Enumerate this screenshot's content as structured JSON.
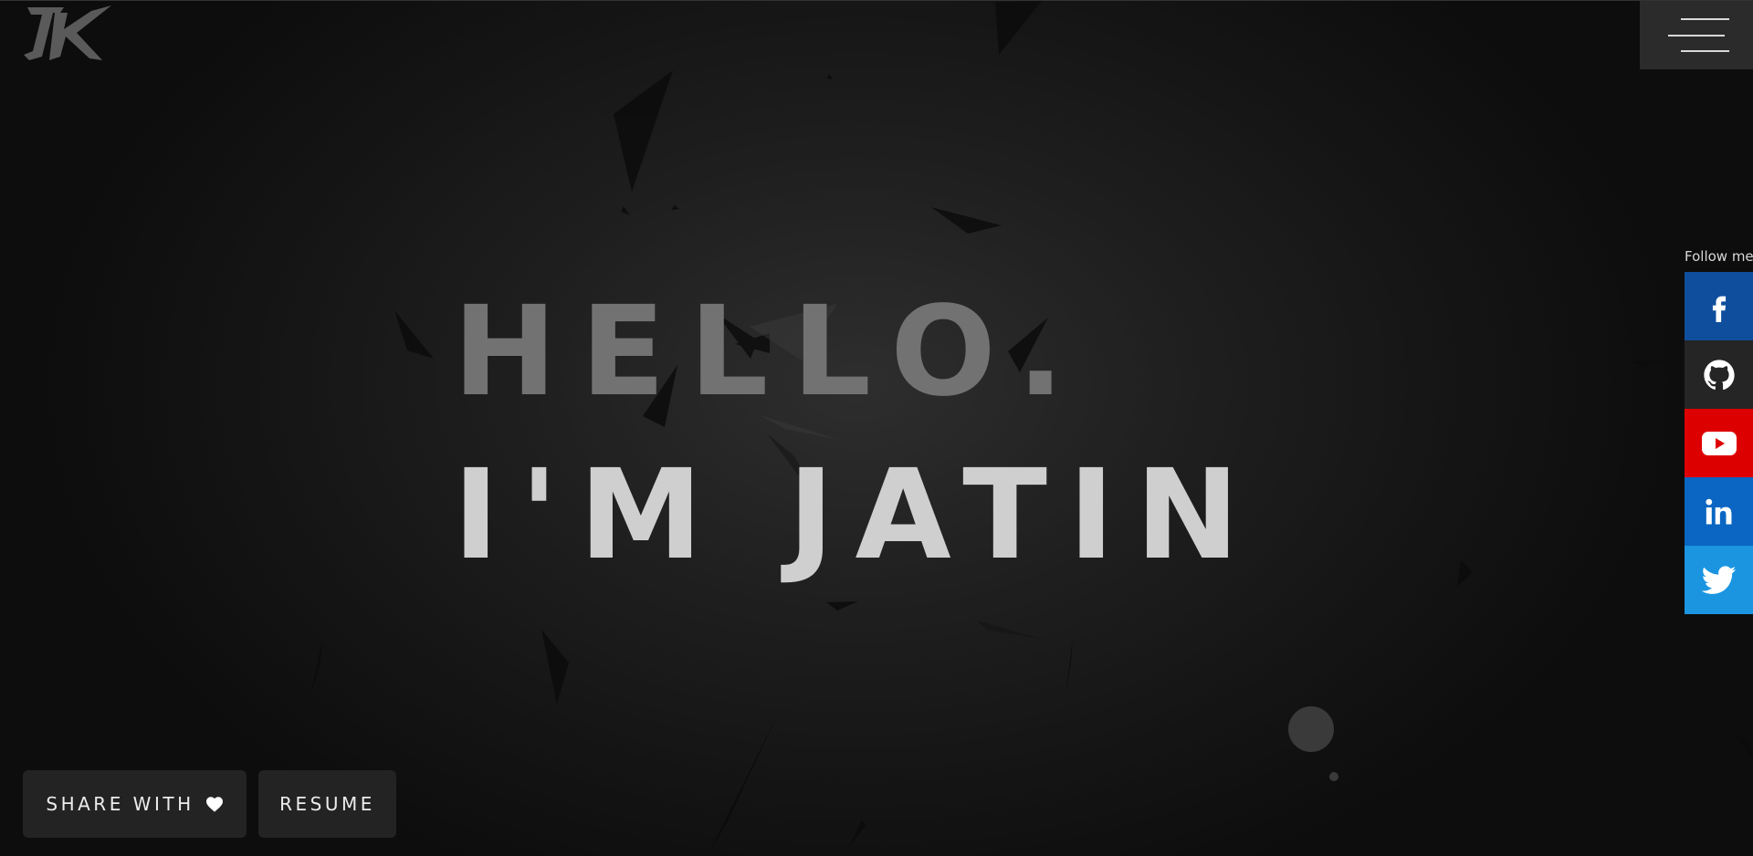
{
  "header": {
    "logo_text": "JK",
    "menu_icon": "hamburger-icon"
  },
  "hero": {
    "line1": "HELLO.",
    "line2": "I'M JATIN"
  },
  "social": {
    "label": "Follow me",
    "items": [
      {
        "name": "facebook",
        "icon": "facebook-icon",
        "color": "#0f4e9c"
      },
      {
        "name": "github",
        "icon": "github-icon",
        "color": "#252525"
      },
      {
        "name": "youtube",
        "icon": "youtube-icon",
        "color": "#dd0000"
      },
      {
        "name": "linkedin",
        "icon": "linkedin-icon",
        "color": "#0a66c2"
      },
      {
        "name": "twitter",
        "icon": "twitter-icon",
        "color": "#1b95e0"
      }
    ]
  },
  "actions": {
    "share_label": "SHARE WITH",
    "share_icon": "heart-icon",
    "resume_label": "RESUME"
  },
  "colors": {
    "hero_line1": "#727272",
    "hero_line2": "#cfcfcf",
    "button_bg": "#232323",
    "menu_bg": "#2b2b2b"
  }
}
